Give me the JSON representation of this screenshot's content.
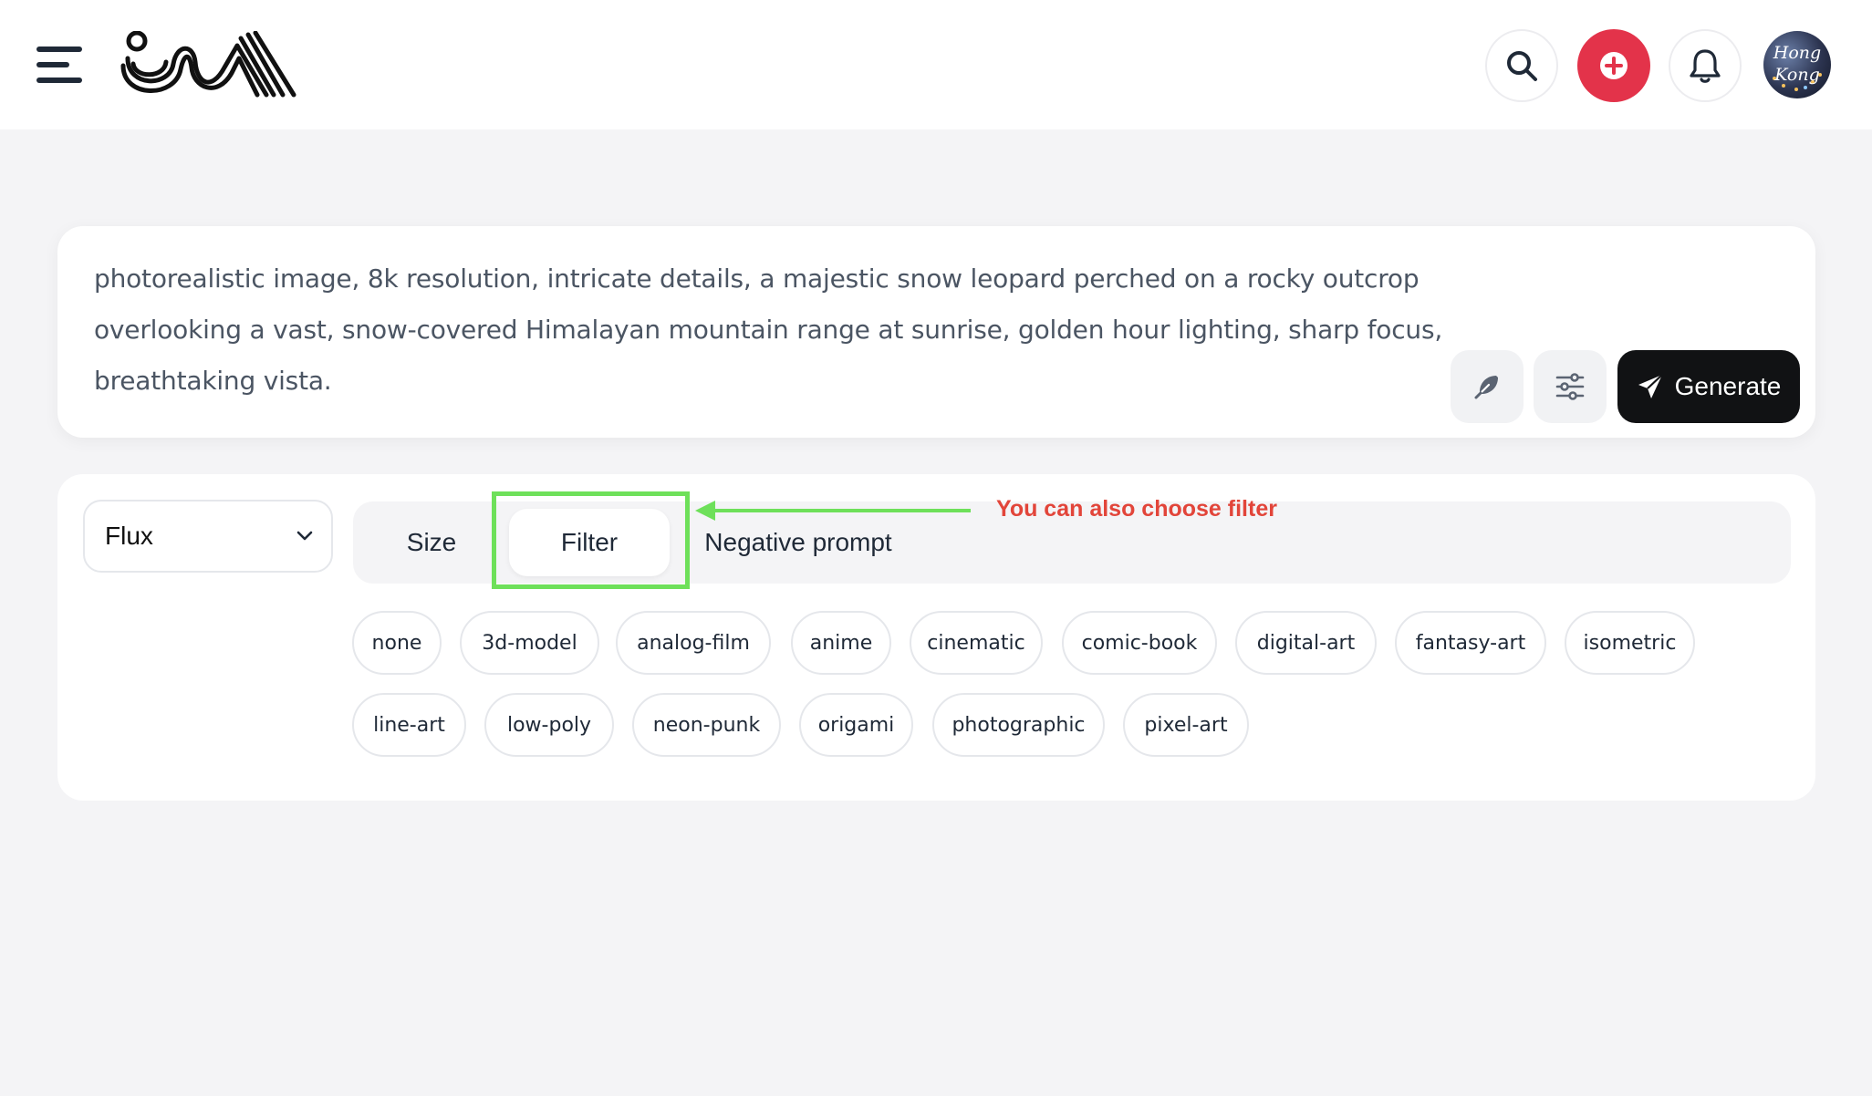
{
  "header": {
    "menu_icon": "hamburger-menu-icon",
    "logo_icon": "brand-logo",
    "actions": [
      {
        "name": "search",
        "icon": "search-icon"
      },
      {
        "name": "create",
        "icon": "plus-icon",
        "color": "#e3334a"
      },
      {
        "name": "notifications",
        "icon": "bell-icon"
      }
    ],
    "avatar_text": "Hong Kong"
  },
  "prompt": {
    "text": "photorealistic image, 8k resolution, intricate details, a majestic snow leopard perched on a rocky outcrop overlooking a vast, snow-covered Himalayan mountain range at sunrise, golden hour lighting, sharp focus,  breathtaking vista.",
    "enhance_icon": "feather-icon",
    "settings_icon": "sliders-icon",
    "generate_label": "Generate",
    "generate_icon": "send-icon"
  },
  "options": {
    "model": "Flux",
    "tabs": [
      {
        "label": "Size"
      },
      {
        "label": "Filter",
        "active": true
      },
      {
        "label": "Negative prompt"
      }
    ],
    "annotation": "You can also choose filter",
    "filters": [
      "none",
      "3d-model",
      "analog-film",
      "anime",
      "cinematic",
      "comic-book",
      "digital-art",
      "fantasy-art",
      "isometric",
      "line-art",
      "low-poly",
      "neon-punk",
      "origami",
      "photographic",
      "pixel-art"
    ]
  },
  "colors": {
    "accent": "#e3334a",
    "generate_bg": "#111214",
    "highlight": "#6ee05a",
    "annotation": "#e2453a"
  }
}
